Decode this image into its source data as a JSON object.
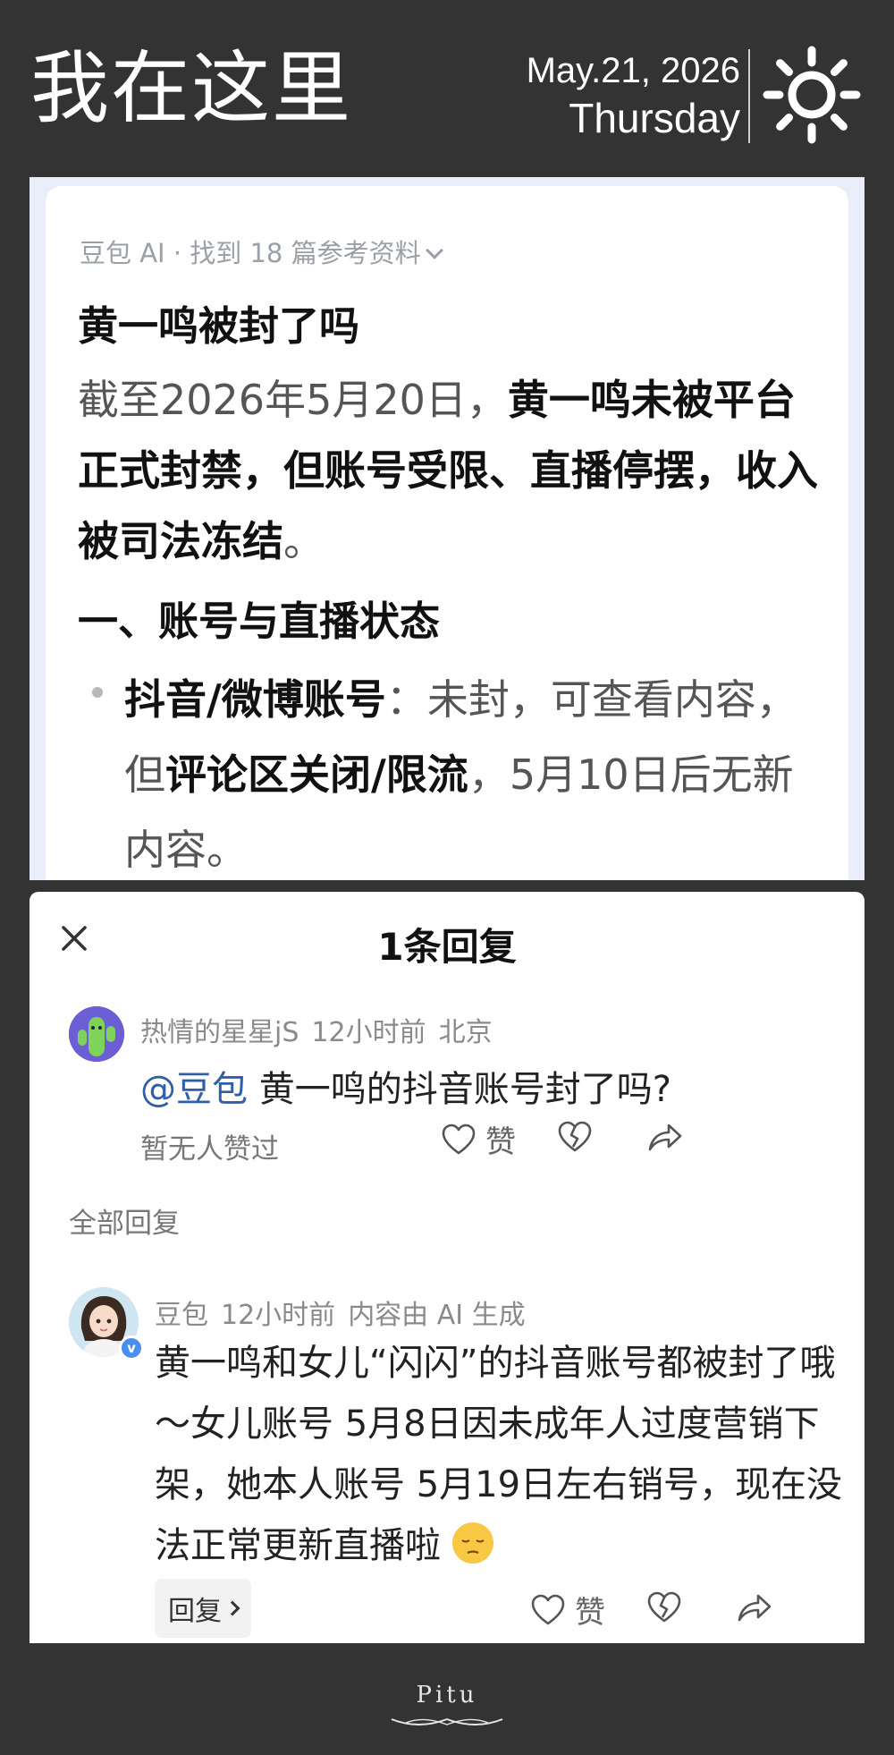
{
  "header": {
    "title": "我在这里",
    "date": "May.21, 2026",
    "weekday": "Thursday",
    "weather_icon": "sun-icon"
  },
  "ai_card": {
    "source_line": "豆包 AI · 找到 18 篇参考资料",
    "question": "黄一鸣被封了吗",
    "answer_lead": "截至2026年5月20日，",
    "answer_bold": "黄一鸣未被平台正式封禁，但账号受限、直播停摆，收入被司法冻结",
    "answer_end": "。",
    "section_heading": "一、账号与直播状态",
    "bullet_label": "抖音/微博账号",
    "bullet_colon": "：",
    "bullet_text_1": "未封，可查看内容，但",
    "bullet_bold_2": "评论区关闭/限流",
    "bullet_text_3": "，5月10日后无新内容。"
  },
  "sheet": {
    "title": "1条回复",
    "close_icon": "close-icon",
    "comment": {
      "user": "热情的星星jS",
      "time": "12小时前",
      "location": "北京",
      "mention": "@豆包",
      "text": " 黄一鸣的抖音账号封了吗?",
      "likes_label": "暂无人赞过",
      "like_label": "赞"
    },
    "all_replies_label": "全部回复",
    "reply": {
      "user": "豆包",
      "time": "12小时前",
      "ai_note": "内容由 AI 生成",
      "text": "黄一鸣和女儿“闪闪”的抖音账号都被封了哦～女儿账号 5月8日因未成年人过度营销下架，她本人账号 5月19日左右销号，现在没法正常更新直播啦 ",
      "reply_button": "回复",
      "like_label": "赞"
    }
  },
  "footer": {
    "brand": "Pitu"
  }
}
